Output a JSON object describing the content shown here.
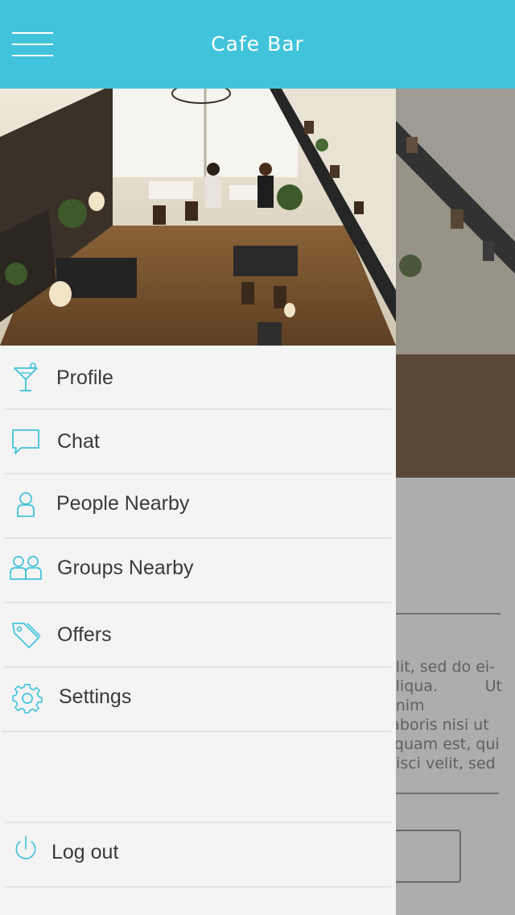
{
  "header": {
    "title": "Cafe Bar",
    "menu_icon": "hamburger-icon",
    "bg_color": "#41c3dc"
  },
  "drawer": {
    "hero_image": "cafe-interior-photo",
    "items": [
      {
        "label": "Profile",
        "icon": "cocktail-icon"
      },
      {
        "label": "Chat",
        "icon": "chat-bubble-icon"
      },
      {
        "label": "People Nearby",
        "icon": "person-icon"
      },
      {
        "label": "Groups Nearby",
        "icon": "group-icon"
      },
      {
        "label": "Offers",
        "icon": "tag-icon"
      },
      {
        "label": "Settings",
        "icon": "gear-icon"
      }
    ],
    "logout": {
      "label": "Log out",
      "icon": "power-icon"
    },
    "accent_color": "#41c3dc"
  },
  "background": {
    "text_lines": [
      "elit, sed do ei-",
      "aliqua. Ut enim",
      "laboris nisi ut",
      "squam est, qui",
      "pisci velit, sed"
    ]
  }
}
